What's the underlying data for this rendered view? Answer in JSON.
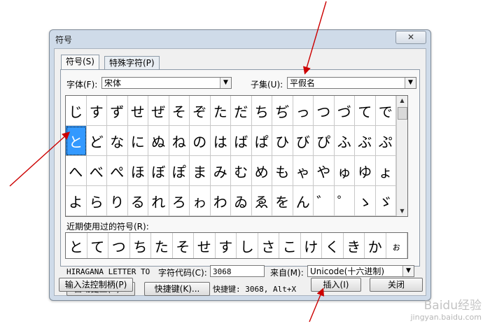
{
  "window": {
    "title": "符号",
    "close_glyph": "✕"
  },
  "tabs": [
    {
      "label": "符号(S)",
      "active": true
    },
    {
      "label": "特殊字符(P)",
      "active": false
    }
  ],
  "font": {
    "label": "字体(F):",
    "value": "宋体"
  },
  "subset": {
    "label": "子集(U):",
    "value": "平假名"
  },
  "symbols": [
    [
      "じ",
      "す",
      "ず",
      "せ",
      "ぜ",
      "そ",
      "ぞ",
      "た",
      "だ",
      "ち",
      "ぢ",
      "っ",
      "つ",
      "づ",
      "て",
      "で"
    ],
    [
      "と",
      "ど",
      "な",
      "に",
      "ぬ",
      "ね",
      "の",
      "は",
      "ば",
      "ぱ",
      "ひ",
      "び",
      "ぴ",
      "ふ",
      "ぶ",
      "ぷ"
    ],
    [
      "へ",
      "べ",
      "ぺ",
      "ほ",
      "ぼ",
      "ぽ",
      "ま",
      "み",
      "む",
      "め",
      "も",
      "ゃ",
      "や",
      "ゅ",
      "ゆ",
      "ょ"
    ],
    [
      "よ",
      "ら",
      "り",
      "る",
      "れ",
      "ろ",
      "ゎ",
      "わ",
      "ゐ",
      "ゑ",
      "を",
      "ん",
      "゛",
      "゜",
      "ゝ",
      "ゞ"
    ]
  ],
  "selected_symbol": "と",
  "recent": {
    "label": "近期使用过的符号(R):",
    "items": [
      "と",
      "て",
      "つ",
      "ち",
      "た",
      "そ",
      "せ",
      "す",
      "し",
      "さ",
      "こ",
      "け",
      "く",
      "き",
      "か",
      "ぉ"
    ]
  },
  "char_name": "HIRAGANA LETTER TO",
  "char_code": {
    "label": "字符代码(C):",
    "value": "3068"
  },
  "from": {
    "label": "来自(M):",
    "value": "Unicode(十六进制)"
  },
  "buttons": {
    "autocorrect": "自动更正(A)...",
    "shortcut_key": "快捷键(K)...",
    "ime_pad": "输入法控制柄(P)",
    "insert": "插入(I)",
    "close": "关闭"
  },
  "shortcut_info": "快捷键: 3068, Alt+X",
  "watermark": {
    "line1": "Baidu经验",
    "line2": "jingyan.baidu.com"
  },
  "colors": {
    "selection": "#3399ff",
    "arrow": "#cc0000"
  }
}
